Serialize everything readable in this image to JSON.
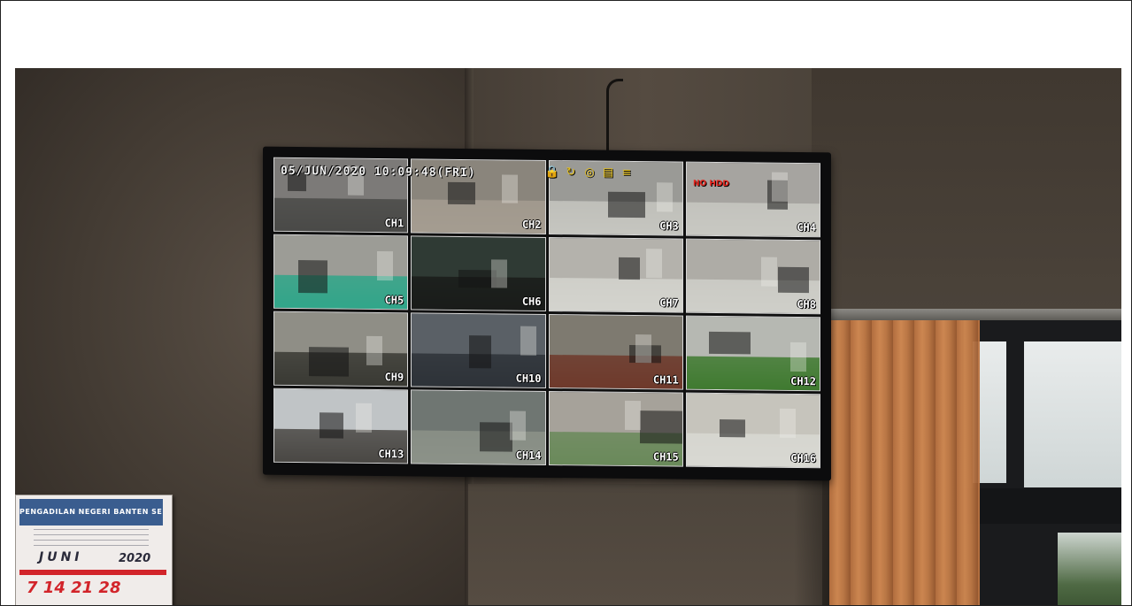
{
  "osd": {
    "datetime": "05/JUN/2020 10:09:48(FRI)",
    "icons": [
      "lock-icon",
      "record-icon",
      "network-icon",
      "hdd-icon",
      "signal-icon"
    ],
    "no_hdd": "NO HDD"
  },
  "channels": [
    {
      "label": "CH1",
      "wall": "#7c7a78",
      "floor": "#4a4a48"
    },
    {
      "label": "CH2",
      "wall": "#8a857c",
      "floor": "#a49c90"
    },
    {
      "label": "CH3",
      "wall": "#9a9a96",
      "floor": "#c5c6c0"
    },
    {
      "label": "CH4",
      "wall": "#a6a4a0",
      "floor": "#c8c8c2"
    },
    {
      "label": "CH5",
      "wall": "#9c9c96",
      "floor": "#31a68a"
    },
    {
      "label": "CH6",
      "wall": "#2f3a34",
      "floor": "#1a1c1a"
    },
    {
      "label": "CH7",
      "wall": "#b4b2ac",
      "floor": "#d4d4ce"
    },
    {
      "label": "CH8",
      "wall": "#aeaca6",
      "floor": "#cfcfc9"
    },
    {
      "label": "CH9",
      "wall": "#8f8e86",
      "floor": "#3a3a34"
    },
    {
      "label": "CH10",
      "wall": "#5a6066",
      "floor": "#2e3338"
    },
    {
      "label": "CH11",
      "wall": "#7e7a70",
      "floor": "#6f3a2c"
    },
    {
      "label": "CH12",
      "wall": "#b6b8b2",
      "floor": "#3f7a30"
    },
    {
      "label": "CH13",
      "wall": "#c0c4c6",
      "floor": "#4a4844"
    },
    {
      "label": "CH14",
      "wall": "#6f7672",
      "floor": "#8c9288"
    },
    {
      "label": "CH15",
      "wall": "#a6a29a",
      "floor": "#6a8a5a"
    },
    {
      "label": "CH16",
      "wall": "#c6c4bc",
      "floor": "#d8d8d2"
    }
  ],
  "calendar": {
    "header": "PENGADILAN NEGERI BANTEN SERANG KELAS IA",
    "month": "JUNI",
    "year": "2020",
    "days": "7 14 21 28"
  }
}
